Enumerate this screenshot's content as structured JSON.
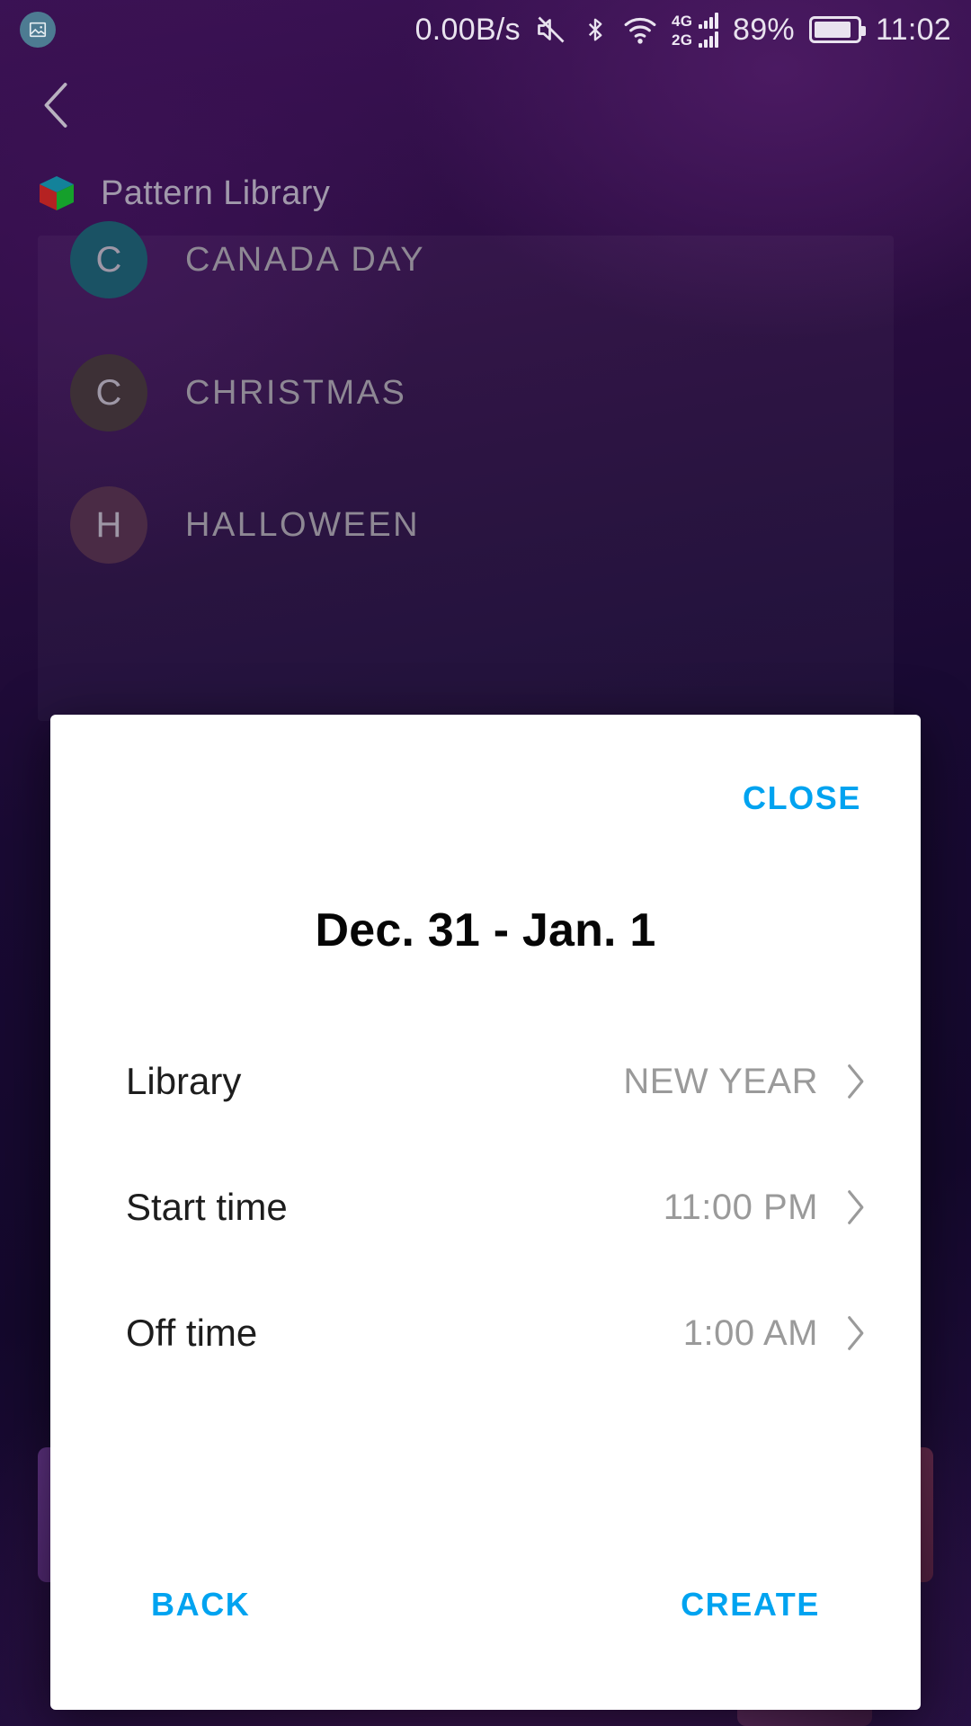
{
  "statusbar": {
    "notification_icon": "screenshot-image-icon",
    "network_speed": "0.00B/s",
    "mute_icon": "mute-speaker-icon",
    "bluetooth_icon": "bluetooth-icon",
    "wifi_icon": "wifi-icon",
    "sim1_label": "4G",
    "sim2_label": "2G",
    "battery_percent": "89%",
    "battery_icon": "battery-icon",
    "clock": "11:02"
  },
  "header": {
    "back_icon": "back-chevron-icon",
    "app_icon": "rgb-cube-icon",
    "title": "Pattern Library"
  },
  "library_list": {
    "items": [
      {
        "initial": "C",
        "label": "CANADA DAY",
        "avatar_color": "#1a5264"
      },
      {
        "initial": "C",
        "label": "CHRISTMAS",
        "avatar_color": "#3d3036"
      },
      {
        "initial": "H",
        "label": "HALLOWEEN",
        "avatar_color": "#4a2b45"
      }
    ]
  },
  "dialog": {
    "close_label": "CLOSE",
    "title": "Dec. 31 - Jan. 1",
    "rows": [
      {
        "label": "Library",
        "value": "NEW YEAR",
        "chevron": "chevron-right-icon"
      },
      {
        "label": "Start time",
        "value": "11:00 PM",
        "chevron": "chevron-right-icon"
      },
      {
        "label": "Off time",
        "value": "1:00 AM",
        "chevron": "chevron-right-icon"
      }
    ],
    "back_label": "BACK",
    "create_label": "CREATE",
    "accent_color": "#00a3f0"
  }
}
